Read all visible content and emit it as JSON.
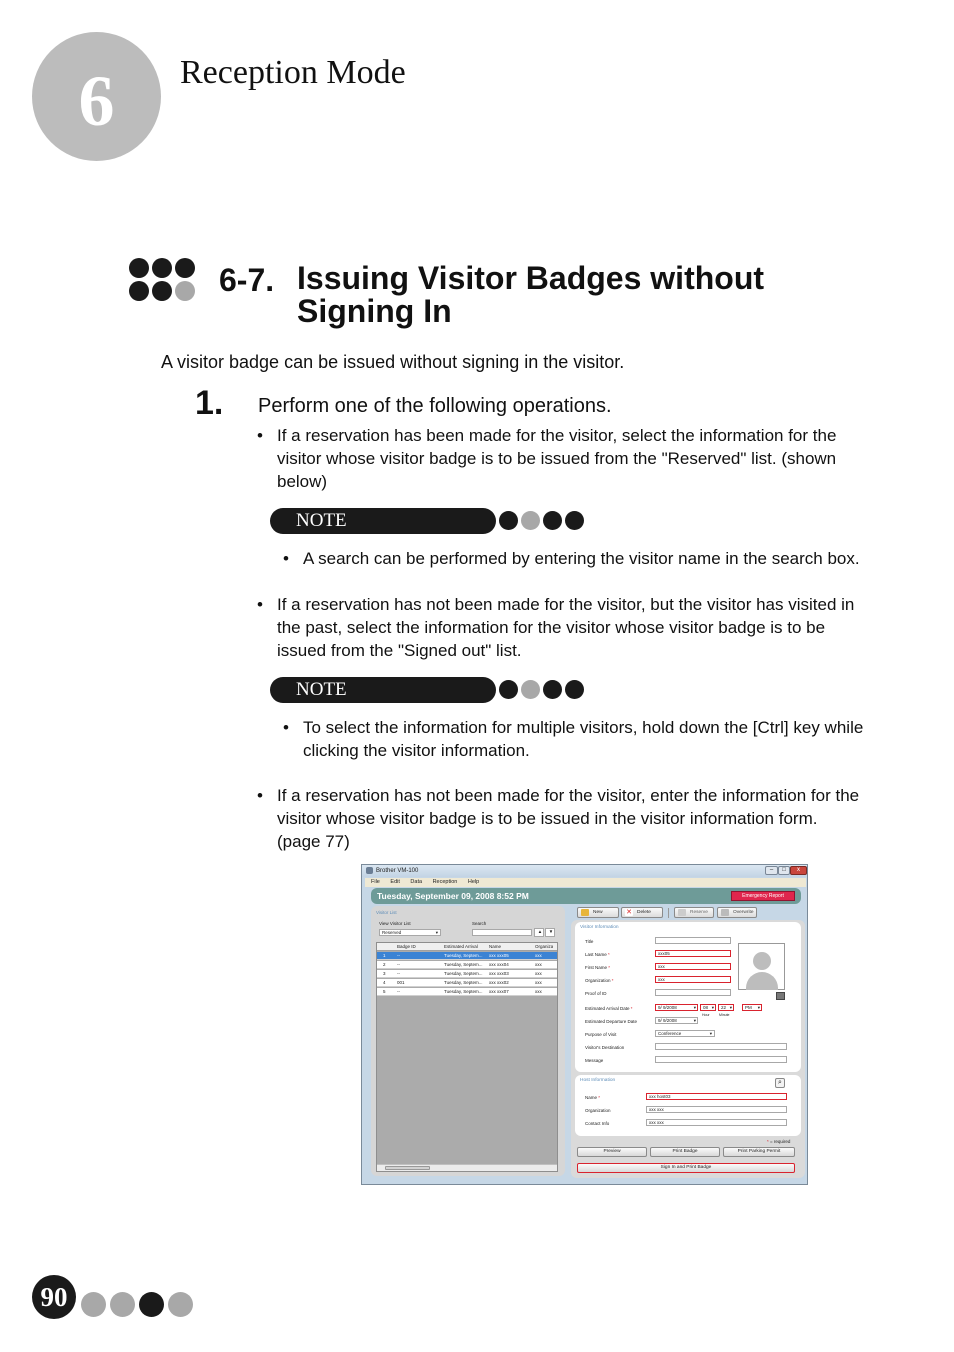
{
  "chapter": {
    "number": "6",
    "title": "Reception Mode"
  },
  "section": {
    "number": "6-7.",
    "title_line1": "Issuing Visitor Badges without",
    "title_line2": "Signing In"
  },
  "intro": "A visitor badge can be issued without signing in the visitor.",
  "step": {
    "number": "1.",
    "text": "Perform one of the following operations."
  },
  "bullets": [
    {
      "lines": [
        "If a reservation has been made for the visitor, select the information for the",
        "visitor whose visitor badge is to be issued from the \"Reserved\" list. (shown",
        "below)"
      ]
    },
    {
      "lines": [
        "If a reservation has not been made for the visitor, but the visitor has visited in",
        "the past, select the information for the visitor whose visitor badge is to be",
        "issued from the \"Signed out\" list."
      ]
    },
    {
      "lines": [
        "If a reservation has not been made for the visitor, enter the information for the",
        "visitor whose visitor badge is to be issued in the visitor information form.",
        "(page 77)"
      ]
    }
  ],
  "notes": [
    {
      "label": "NOTE",
      "text": "A search can be performed by entering the visitor name in the search box."
    },
    {
      "label": "NOTE",
      "lines": [
        "To select the information for multiple visitors, hold down the [Ctrl] key while",
        "clicking the visitor information."
      ]
    }
  ],
  "page_number": "90",
  "app": {
    "window_title": "Brother VM-100",
    "window_buttons": [
      "–",
      "□",
      "x"
    ],
    "menu": [
      "File",
      "Edit",
      "Data",
      "Reception",
      "Help"
    ],
    "datetime": "Tuesday, September 09, 2008 8:52 PM",
    "emergency_button": "Emergency Report",
    "visitor_list": {
      "title": "Visitor List",
      "view_label": "View Visitor List",
      "view_value": "Reserved",
      "search_label": "Search",
      "search_value": "",
      "columns": [
        "",
        "Badge ID",
        "Estimated Arrival",
        "Name",
        "Organiza"
      ],
      "rows": [
        [
          "1",
          "--",
          "Tuesday, Septem...",
          "xxx xxx05",
          "xxx"
        ],
        [
          "2",
          "--",
          "Tuesday, Septem...",
          "xxx xxx04",
          "xxx"
        ],
        [
          "3",
          "--",
          "Tuesday, Septem...",
          "xxx xxx03",
          "xxx"
        ],
        [
          "4",
          "001",
          "Tuesday, Septem...",
          "xxx xxx02",
          "xxx"
        ],
        [
          "5",
          "--",
          "Tuesday, Septem...",
          "xxx xxx07",
          "xxx"
        ]
      ]
    },
    "toolbar": {
      "new": "New",
      "delete": "Delete",
      "reserve": "Reserve",
      "overwrite": "Overwrite"
    },
    "visitor_info": {
      "title": "Visitor Information",
      "fields": {
        "title": {
          "label": "Title",
          "value": ""
        },
        "last_name": {
          "label": "Last Name",
          "value": "xxx05"
        },
        "first_name": {
          "label": "First Name",
          "value": "xxx"
        },
        "organization": {
          "label": "Organization",
          "value": "xxx"
        },
        "proof_of_id": {
          "label": "Proof of ID",
          "value": ""
        },
        "arrival_date": {
          "label": "Estimated Arrival Date",
          "value": "9/ 9/2008",
          "hour": "08",
          "minute": "22",
          "ampm": "PM",
          "hour_label": "Hour",
          "minute_label": "Minute"
        },
        "departure_date": {
          "label": "Estimated Departure Date",
          "value": "9/ 9/2008"
        },
        "purpose": {
          "label": "Purpose of Visit",
          "value": "Conference"
        },
        "destination": {
          "label": "Visitor's Destination",
          "value": ""
        },
        "message": {
          "label": "Message",
          "value": ""
        }
      }
    },
    "host_info": {
      "title": "Host Information",
      "name": {
        "label": "Name",
        "value": "xxx host03"
      },
      "organization": {
        "label": "Organization",
        "value": "xxx xxx"
      },
      "contact": {
        "label": "Contact Info",
        "value": "xxx xxx"
      }
    },
    "required_note": "= required",
    "buttons": {
      "preview": "Preview",
      "print_badge": "Print Badge",
      "print_parking": "Print Parking Permit",
      "sign_in_print": "Sign In and Print Badge"
    }
  }
}
